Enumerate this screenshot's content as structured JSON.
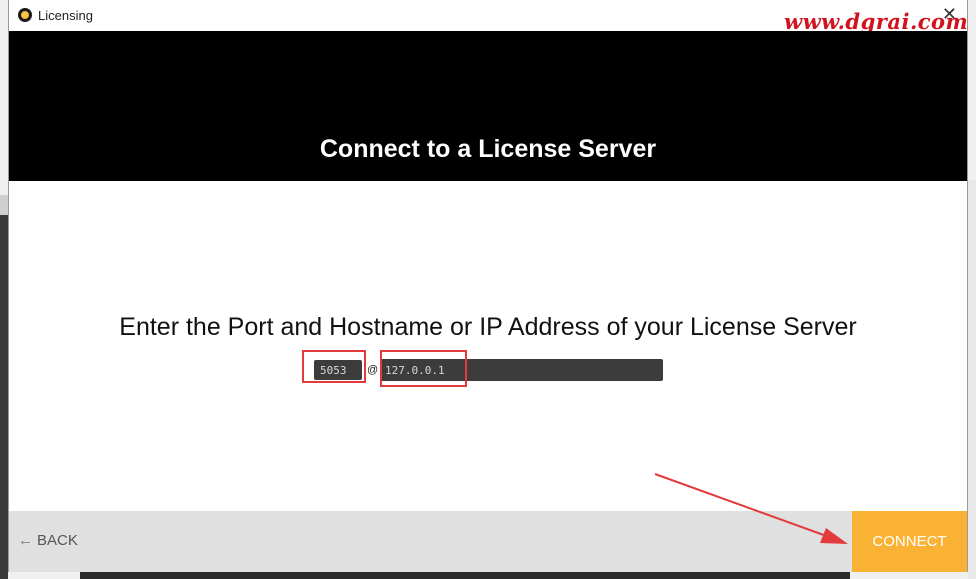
{
  "window": {
    "title": "Licensing",
    "close_glyph": "✕",
    "watermark": "www.dgrai.com"
  },
  "header": {
    "title": "Connect to a License Server"
  },
  "main": {
    "prompt": "Enter the Port and Hostname or IP Address of your License Server",
    "port_value": "5053",
    "separator": "@",
    "host_value": "127.0.0.1"
  },
  "footer": {
    "back_arrow": "←",
    "back_label": "BACK",
    "connect_label": "CONNECT"
  },
  "colors": {
    "header_bg": "#000000",
    "accent": "#f9b233",
    "highlight": "#e23b3b"
  },
  "icons": {
    "app": "app-logo-icon",
    "close": "close-icon",
    "back": "arrow-left-icon"
  }
}
